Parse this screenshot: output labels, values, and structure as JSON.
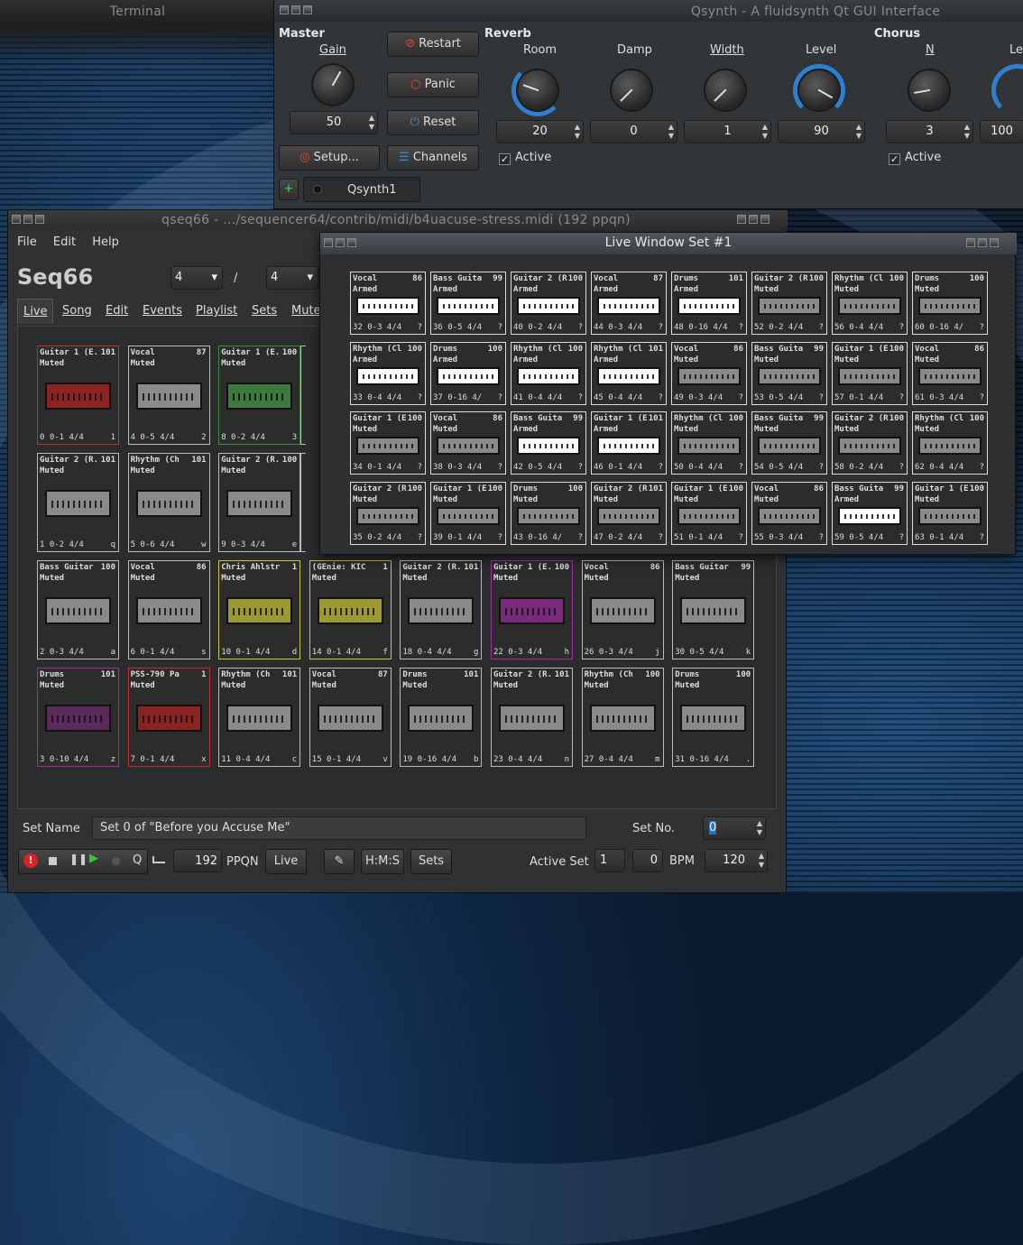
{
  "terminal": {
    "title": "Terminal"
  },
  "qsynth": {
    "title": "Qsynth - A fluidsynth Qt GUI Interface",
    "master": {
      "heading": "Master",
      "gain_label": "Gain",
      "gain_value": "50",
      "restart": "Restart",
      "panic": "Panic",
      "reset": "Reset",
      "setup": "Setup...",
      "channels": "Channels"
    },
    "reverb": {
      "heading": "Reverb",
      "room": "Room",
      "damp": "Damp",
      "width": "Width",
      "level": "Level",
      "room_value": "20",
      "damp_value": "0",
      "width_value": "1",
      "level_value": "90",
      "active": "Active"
    },
    "chorus": {
      "heading": "Chorus",
      "n": "N",
      "level": "Le",
      "n_value": "3",
      "level_value": "100",
      "active": "Active"
    },
    "tab": "Qsynth1"
  },
  "seq66": {
    "title": "qseq66 - .../sequencer64/contrib/midi/b4uacuse-stress.midi (192 ppqn)",
    "menu": [
      "File",
      "Edit",
      "Help"
    ],
    "app_name": "Seq66",
    "beats": "4",
    "beat_width": "4",
    "slash": "/",
    "tabs": [
      "Live",
      "Song",
      "Edit",
      "Events",
      "Playlist",
      "Sets",
      "Mute"
    ],
    "set_name_label": "Set Name",
    "set_name_value": "Set 0 of \"Before you Accuse Me\"",
    "set_no_label": "Set No.",
    "set_no_value": "0",
    "ppqn_value": "192",
    "ppqn_label": "PPQN",
    "live_btn": "Live",
    "hms_btn": "H:M:S",
    "sets_btn": "Sets",
    "active_set_label": "Active Set",
    "active_set_value": "1",
    "active_set_2": "0",
    "bpm_label": "BPM",
    "bpm_value": "120",
    "q_btn": "Q"
  },
  "live_window": {
    "title": "Live Window Set #1"
  },
  "main_tiles": [
    [
      "Guitar 1 (E.",
      "101",
      "Muted",
      "0  0-1 4/4",
      "1",
      "#c03030",
      "#8b2323"
    ],
    [
      "Vocal",
      "87",
      "Muted",
      "4  0-5 4/4",
      "2",
      "",
      ""
    ],
    [
      "Guitar 1 (E.",
      "100",
      "Muted",
      "8  0-2 4/4",
      "3",
      "#3c8a3c",
      "#3e7a3e"
    ],
    [
      "Ba",
      "",
      "Mu",
      "12",
      "",
      "",
      ""
    ],
    [
      "Guitar 2 (R.",
      "101",
      "Muted",
      "1  0-2 4/4",
      "q",
      "",
      ""
    ],
    [
      "Rhythm (Ch",
      "101",
      "Muted",
      "5  0-6 4/4",
      "w",
      "",
      ""
    ],
    [
      "Guitar 2 (R.",
      "100",
      "Muted",
      "9  0-3 4/4",
      "e",
      "",
      ""
    ],
    [
      "Dr",
      "",
      "Mu",
      "13",
      "",
      "",
      ""
    ],
    [
      "Bass Guitar",
      "100",
      "Muted",
      "2  0-3 4/4",
      "a",
      "",
      ""
    ],
    [
      "Vocal",
      "86",
      "Muted",
      "6  0-1 4/4",
      "s",
      "",
      ""
    ],
    [
      "Chris Ahlstr",
      "1",
      "Muted",
      "10  0-1 4/4",
      "d",
      "#c8c830",
      "#9a9a30"
    ],
    [
      "(GEnie: KIC",
      "1",
      "Muted",
      "14  0-1 4/4",
      "f",
      "#c8c830",
      "#9a9a30"
    ],
    [
      "Guitar 2 (R.",
      "101",
      "Muted",
      "18  0-4 4/4",
      "g",
      "",
      ""
    ],
    [
      "Guitar 1 (E.",
      "100",
      "Muted",
      "22  0-3 4/4",
      "h",
      "#a030a0",
      "#7a2a7a"
    ],
    [
      "Vocal",
      "86",
      "Muted",
      "26  0-3 4/4",
      "j",
      "",
      ""
    ],
    [
      "Bass Guitar",
      "99",
      "Muted",
      "30  0-5 4/4",
      "k",
      "",
      ""
    ],
    [
      "Drums",
      "101",
      "Muted",
      "3  0-10 4/4",
      "z",
      "#a030a0",
      "#5a2a5a"
    ],
    [
      "PSS-790 Pa",
      "1",
      "Muted",
      "7  0-1 4/4",
      "x",
      "#c03030",
      "#8b2323"
    ],
    [
      "Rhythm (Ch",
      "101",
      "Muted",
      "11  0-4 4/4",
      "c",
      "",
      ""
    ],
    [
      "Vocal",
      "87",
      "Muted",
      "15  0-1 4/4",
      "v",
      "",
      ""
    ],
    [
      "Drums",
      "101",
      "Muted",
      "19  0-16 4/4",
      "b",
      "",
      ""
    ],
    [
      "Guitar 2 (R.",
      "101",
      "Muted",
      "23  0-4 4/4",
      "n",
      "",
      ""
    ],
    [
      "Rhythm (Ch",
      "100",
      "Muted",
      "27  0-4 4/4",
      "m",
      "",
      ""
    ],
    [
      "Drums",
      "100",
      "Muted",
      "31  0-16 4/4",
      ".",
      "",
      ""
    ]
  ],
  "live_tiles": [
    [
      "Vocal",
      "86",
      "Armed",
      "32  0-3 4/4",
      "?"
    ],
    [
      "Bass Guita",
      "99",
      "Armed",
      "36  0-5 4/4",
      "?"
    ],
    [
      "Guitar 2 (R",
      "100",
      "Armed",
      "40  0-2 4/4",
      "?"
    ],
    [
      "Vocal",
      "87",
      "Armed",
      "44  0-3 4/4",
      "?"
    ],
    [
      "Drums",
      "101",
      "Armed",
      "48  0-16 4/4",
      "?"
    ],
    [
      "Guitar 2 (R",
      "100",
      "Muted",
      "52  0-2 4/4",
      "?"
    ],
    [
      "Rhythm (Cl",
      "100",
      "Muted",
      "56  0-4 4/4",
      "?"
    ],
    [
      "Drums",
      "100",
      "Muted",
      "60  0-16 4/",
      "?"
    ],
    [
      "Rhythm (Cl",
      "100",
      "Armed",
      "33  0-4 4/4",
      "?"
    ],
    [
      "Drums",
      "100",
      "Armed",
      "37  0-16 4/",
      "?"
    ],
    [
      "Rhythm (Cl",
      "100",
      "Armed",
      "41  0-4 4/4",
      "?"
    ],
    [
      "Rhythm (Cl",
      "101",
      "Armed",
      "45  0-4 4/4",
      "?"
    ],
    [
      "Vocal",
      "86",
      "Muted",
      "49  0-3 4/4",
      "?"
    ],
    [
      "Bass Guita",
      "99",
      "Muted",
      "53  0-5 4/4",
      "?"
    ],
    [
      "Guitar 1 (E",
      "100",
      "Muted",
      "57  0-1 4/4",
      "?"
    ],
    [
      "Vocal",
      "86",
      "Muted",
      "61  0-3 4/4",
      "?"
    ],
    [
      "Guitar 1 (E",
      "100",
      "Muted",
      "34  0-1 4/4",
      "?"
    ],
    [
      "Vocal",
      "86",
      "Muted",
      "38  0-3 4/4",
      "?"
    ],
    [
      "Bass Guita",
      "99",
      "Armed",
      "42  0-5 4/4",
      "?"
    ],
    [
      "Guitar 1 (E",
      "101",
      "Armed",
      "46  0-1 4/4",
      "?"
    ],
    [
      "Rhythm (Cl",
      "100",
      "Muted",
      "50  0-4 4/4",
      "?"
    ],
    [
      "Bass Guita",
      "99",
      "Muted",
      "54  0-5 4/4",
      "?"
    ],
    [
      "Guitar 2 (R",
      "100",
      "Muted",
      "58  0-2 4/4",
      "?"
    ],
    [
      "Rhythm (Cl",
      "100",
      "Muted",
      "62  0-4 4/4",
      "?"
    ],
    [
      "Guitar 2 (R",
      "100",
      "Muted",
      "35  0-2 4/4",
      "?"
    ],
    [
      "Guitar 1 (E",
      "100",
      "Muted",
      "39  0-1 4/4",
      "?"
    ],
    [
      "Drums",
      "100",
      "Muted",
      "43  0-16 4/",
      "?"
    ],
    [
      "Guitar 2 (R",
      "101",
      "Muted",
      "47  0-2 4/4",
      "?"
    ],
    [
      "Guitar 1 (E",
      "100",
      "Muted",
      "51  0-1 4/4",
      "?"
    ],
    [
      "Vocal",
      "86",
      "Muted",
      "55  0-3 4/4",
      "?"
    ],
    [
      "Bass Guita",
      "99",
      "Armed",
      "59  0-5 4/4",
      "?"
    ],
    [
      "Guitar 1 (E",
      "100",
      "Muted",
      "63  0-1 4/4",
      "?"
    ]
  ]
}
